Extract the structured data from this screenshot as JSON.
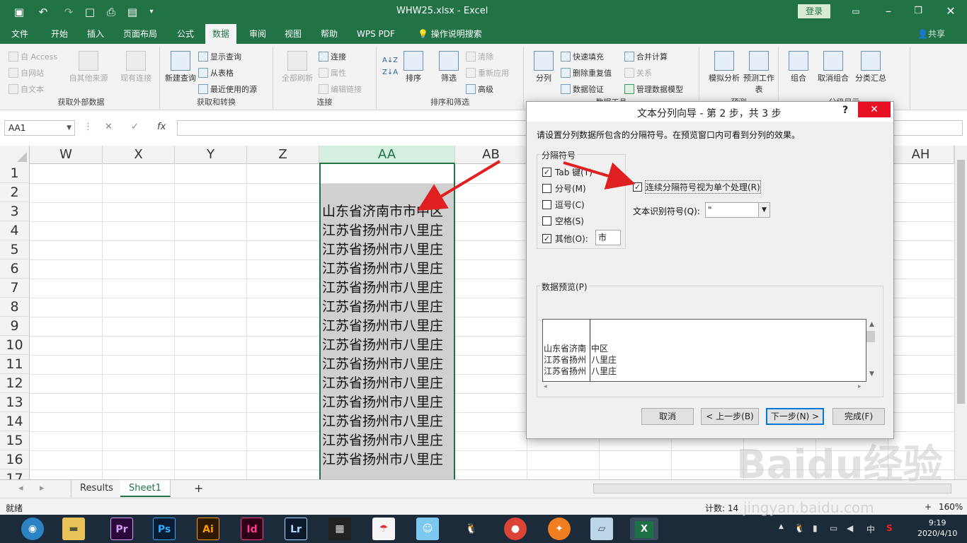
{
  "window": {
    "title": "WHW25.xlsx  -  Excel",
    "login_label": "登录",
    "minimize": "–",
    "restore": "❐",
    "close": "✕"
  },
  "menu": {
    "tabs": [
      "文件",
      "开始",
      "插入",
      "页面布局",
      "公式",
      "数据",
      "审阅",
      "视图",
      "帮助",
      "WPS PDF",
      "操作说明搜索"
    ],
    "active_tab": "数据",
    "share": "共享"
  },
  "ribbon": {
    "groups": [
      {
        "label": "获取外部数据",
        "items": [
          "自 Access",
          "自网站",
          "自文本",
          "自其他来源",
          "现有连接"
        ]
      },
      {
        "label": "获取和转换",
        "items": [
          "新建查询",
          "显示查询",
          "从表格",
          "最近使用的源"
        ]
      },
      {
        "label": "连接",
        "items": [
          "全部刷新",
          "连接",
          "属性",
          "编辑链接"
        ]
      },
      {
        "label": "排序和筛选",
        "items": [
          "排序",
          "筛选",
          "清除",
          "重新应用",
          "高级"
        ]
      },
      {
        "label": "数据工具",
        "items": [
          "分列",
          "快速填充",
          "删除重复值",
          "数据验证",
          "合并计算",
          "关系",
          "管理数据模型"
        ]
      },
      {
        "label": "预测",
        "items": [
          "模拟分析",
          "预测工作表"
        ]
      },
      {
        "label": "分级显示",
        "items": [
          "组合",
          "取消组合",
          "分类汇总"
        ]
      }
    ]
  },
  "formula_bar": {
    "name_box": "AA1",
    "fx": "fx",
    "value": ""
  },
  "grid": {
    "columns": [
      "W",
      "X",
      "Y",
      "Z",
      "AA",
      "AB",
      "AH"
    ],
    "selected_column": "AA",
    "rows": [
      "1",
      "2",
      "3",
      "4",
      "5",
      "6",
      "7",
      "8",
      "9",
      "10",
      "11",
      "12",
      "13",
      "14",
      "15",
      "16",
      "17"
    ],
    "aa_cells": [
      "",
      "",
      "山东省济南市市中区",
      "江苏省扬州市八里庄",
      "江苏省扬州市八里庄",
      "江苏省扬州市八里庄",
      "江苏省扬州市八里庄",
      "江苏省扬州市八里庄",
      "江苏省扬州市八里庄",
      "江苏省扬州市八里庄",
      "江苏省扬州市八里庄",
      "江苏省扬州市八里庄",
      "江苏省扬州市八里庄",
      "江苏省扬州市八里庄",
      "江苏省扬州市八里庄",
      "江苏省扬州市八里庄"
    ]
  },
  "sheets": {
    "tabs": [
      "Results",
      "Sheet1"
    ],
    "active": "Sheet1",
    "add": "+"
  },
  "status": {
    "mode": "就绪",
    "count_label": "计数: 14",
    "zoom": "160%"
  },
  "dialog": {
    "title": "文本分列向导 - 第 2 步，共 3 步",
    "help": "?",
    "close": "✕",
    "instruction": "请设置分列数据所包含的分隔符号。在预览窗口内可看到分列的效果。",
    "delimiters_legend": "分隔符号",
    "delimiters": [
      {
        "label": "Tab 键(T)",
        "checked": true
      },
      {
        "label": "分号(M)",
        "checked": false
      },
      {
        "label": "逗号(C)",
        "checked": false
      },
      {
        "label": "空格(S)",
        "checked": false
      },
      {
        "label": "其他(O):",
        "checked": true
      }
    ],
    "other_value": "市",
    "consecutive_label": "连续分隔符号视为单个处理(R)",
    "consecutive_checked": true,
    "qualifier_label": "文本识别符号(Q):",
    "qualifier_value": "\"",
    "preview_label": "数据预览(P)",
    "preview_rows": [
      [
        "山东省济南",
        "中区"
      ],
      [
        "江苏省扬州",
        "八里庄"
      ],
      [
        "江苏省扬州",
        "八里庄"
      ]
    ],
    "buttons": {
      "cancel": "取消",
      "back": "< 上一步(B)",
      "next": "下一步(N) >",
      "finish": "完成(F)"
    }
  },
  "taskbar": {
    "apps": [
      "Pr",
      "Ps",
      "Ai",
      "Id",
      "Lr"
    ],
    "time": "9:19",
    "date": "2020/4/10",
    "ime": "中"
  },
  "watermark": {
    "brand": "Baidu经验",
    "url": "jingyan.baidu.com"
  },
  "colors": {
    "excel_green": "#217346",
    "arrow_red": "#e02020"
  }
}
